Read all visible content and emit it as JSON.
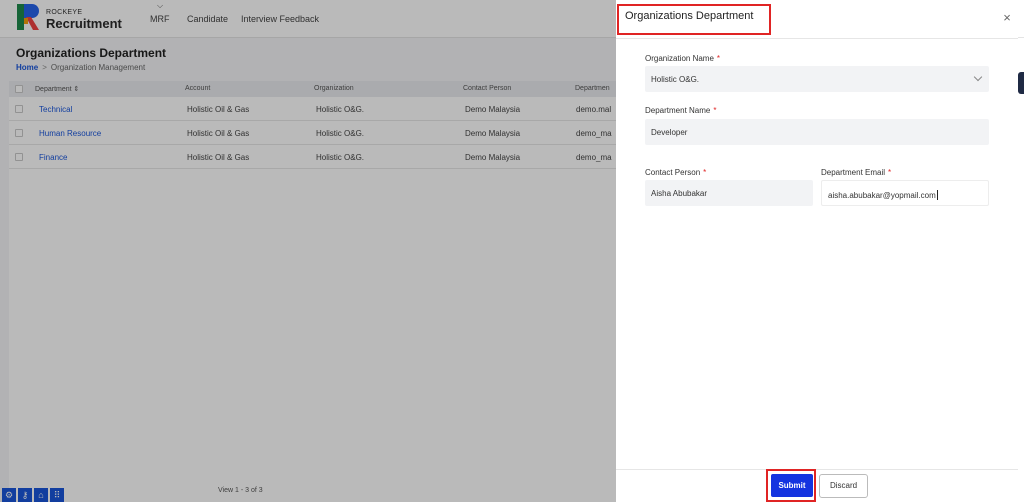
{
  "app": {
    "brand_top": "ROCKEYE",
    "brand_name": "Recruitment",
    "nav": [
      "MRF",
      "Candidate",
      "Interview Feedback"
    ]
  },
  "page": {
    "title": "Organizations Department",
    "breadcrumb": {
      "home": "Home",
      "sep": ">",
      "current": "Organization Management"
    }
  },
  "grid": {
    "headers": [
      "Department",
      "Account",
      "Organization",
      "Contact Person",
      "Departmen"
    ],
    "rows": [
      {
        "department": "Technical",
        "account": "Holistic Oil & Gas",
        "organization": "Holistic O&G.",
        "contact": "Demo Malaysia",
        "email": "demo.mal"
      },
      {
        "department": "Human Resource",
        "account": "Holistic Oil & Gas",
        "organization": "Holistic O&G.",
        "contact": "Demo Malaysia",
        "email": "demo_ma"
      },
      {
        "department": "Finance",
        "account": "Holistic Oil & Gas",
        "organization": "Holistic O&G.",
        "contact": "Demo Malaysia",
        "email": "demo_ma"
      }
    ],
    "footer": "View 1 - 3 of 3"
  },
  "drawer": {
    "title": "Organizations Department",
    "close": "×",
    "org_label": "Organization Name",
    "org_value": "Holistic O&G.",
    "dept_label": "Department Name",
    "dept_value": "Developer",
    "contact_label": "Contact Person",
    "contact_value": "Aisha Abubakar",
    "email_label": "Department Email",
    "email_value": "aisha.abubakar@yopmail.com",
    "required_mark": "*",
    "submit": "Submit",
    "discard": "Discard"
  },
  "colors": {
    "primary": "#1434e0",
    "link": "#1a56db",
    "highlight": "#e02424"
  }
}
